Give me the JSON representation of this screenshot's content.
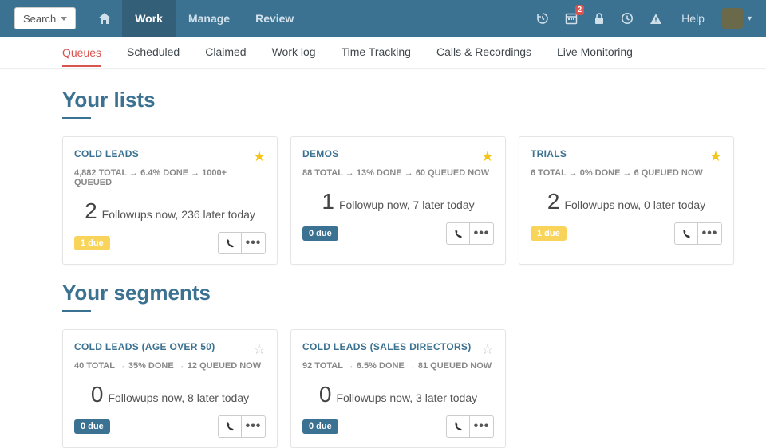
{
  "topbar": {
    "search_label": "Search",
    "nav": [
      {
        "label": "Work",
        "active": true
      },
      {
        "label": "Manage",
        "active": false
      },
      {
        "label": "Review",
        "active": false
      }
    ],
    "calendar_badge": "2",
    "help_label": "Help"
  },
  "subnav": [
    {
      "label": "Queues",
      "active": true
    },
    {
      "label": "Scheduled",
      "active": false
    },
    {
      "label": "Claimed",
      "active": false
    },
    {
      "label": "Work log",
      "active": false
    },
    {
      "label": "Time Tracking",
      "active": false
    },
    {
      "label": "Calls & Recordings",
      "active": false
    },
    {
      "label": "Live Monitoring",
      "active": false
    }
  ],
  "sections": {
    "lists_title": "Your lists",
    "segments_title": "Your segments"
  },
  "lists": [
    {
      "title": "COLD LEADS",
      "stats": "4,882 TOTAL → 6.4% DONE → 1000+ QUEUED",
      "followup_num": "2",
      "followup_text": "Followups now, 236 later today",
      "due": "1 due",
      "due_style": "yellow",
      "starred": true
    },
    {
      "title": "DEMOS",
      "stats": "88 TOTAL → 13% DONE → 60 QUEUED NOW",
      "followup_num": "1",
      "followup_text": "Followup now, 7 later today",
      "due": "0 due",
      "due_style": "blue",
      "starred": true
    },
    {
      "title": "TRIALS",
      "stats": "6 TOTAL → 0% DONE → 6 QUEUED NOW",
      "followup_num": "2",
      "followup_text": "Followups now, 0 later today",
      "due": "1 due",
      "due_style": "yellow",
      "starred": true
    }
  ],
  "segments": [
    {
      "title": "COLD LEADS (AGE OVER 50)",
      "stats": "40 TOTAL → 35% DONE → 12 QUEUED NOW",
      "followup_num": "0",
      "followup_text": "Followups now, 8 later today",
      "due": "0 due",
      "due_style": "blue",
      "starred": false
    },
    {
      "title": "COLD LEADS (SALES DIRECTORS)",
      "stats": "92 TOTAL → 6.5% DONE → 81 QUEUED NOW",
      "followup_num": "0",
      "followup_text": "Followups now, 3 later today",
      "due": "0 due",
      "due_style": "blue",
      "starred": false
    }
  ]
}
